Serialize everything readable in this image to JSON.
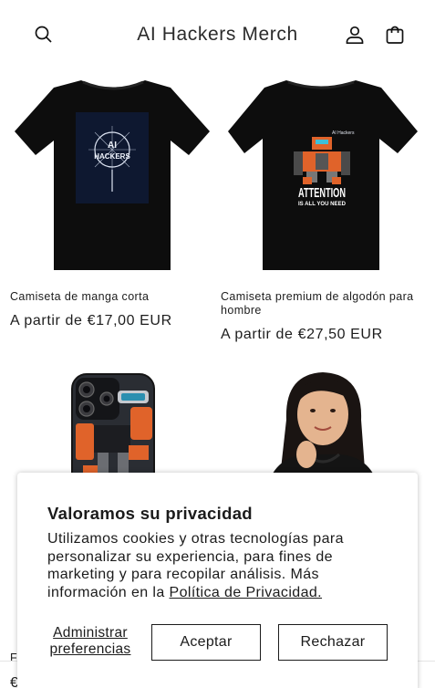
{
  "header": {
    "title": "AI Hackers Merch",
    "icons": {
      "search": "search-icon",
      "account": "user-icon",
      "cart": "cart-icon"
    }
  },
  "products": [
    {
      "title": "Camiseta de manga corta",
      "price": "A partir de €17,00 EUR",
      "shirt_text": [
        "AI",
        "HACKERS"
      ]
    },
    {
      "title": "Camiseta premium de algodón para hombre",
      "price": "A partir de €27,50 EUR",
      "shirt_text": [
        "ATTENTION",
        "IS ALL YOU NEED",
        "AI Hackers"
      ]
    },
    {
      "title": "Fu",
      "price": "€"
    },
    {
      "title": "",
      "price": ""
    }
  ],
  "cookie": {
    "heading": "Valoramos su privacidad",
    "body": "Utilizamos cookies y otras tecnologías para personalizar su experiencia, para fines de marketing y para recopilar análisis. Más información en la",
    "link": "Política de Privacidad.",
    "manage": "Administrar preferencias",
    "accept": "Aceptar",
    "reject": "Rechazar"
  },
  "colors": {
    "text": "#121212",
    "shirt": "#0d0d0d",
    "robot_orange": "#e0632a"
  }
}
